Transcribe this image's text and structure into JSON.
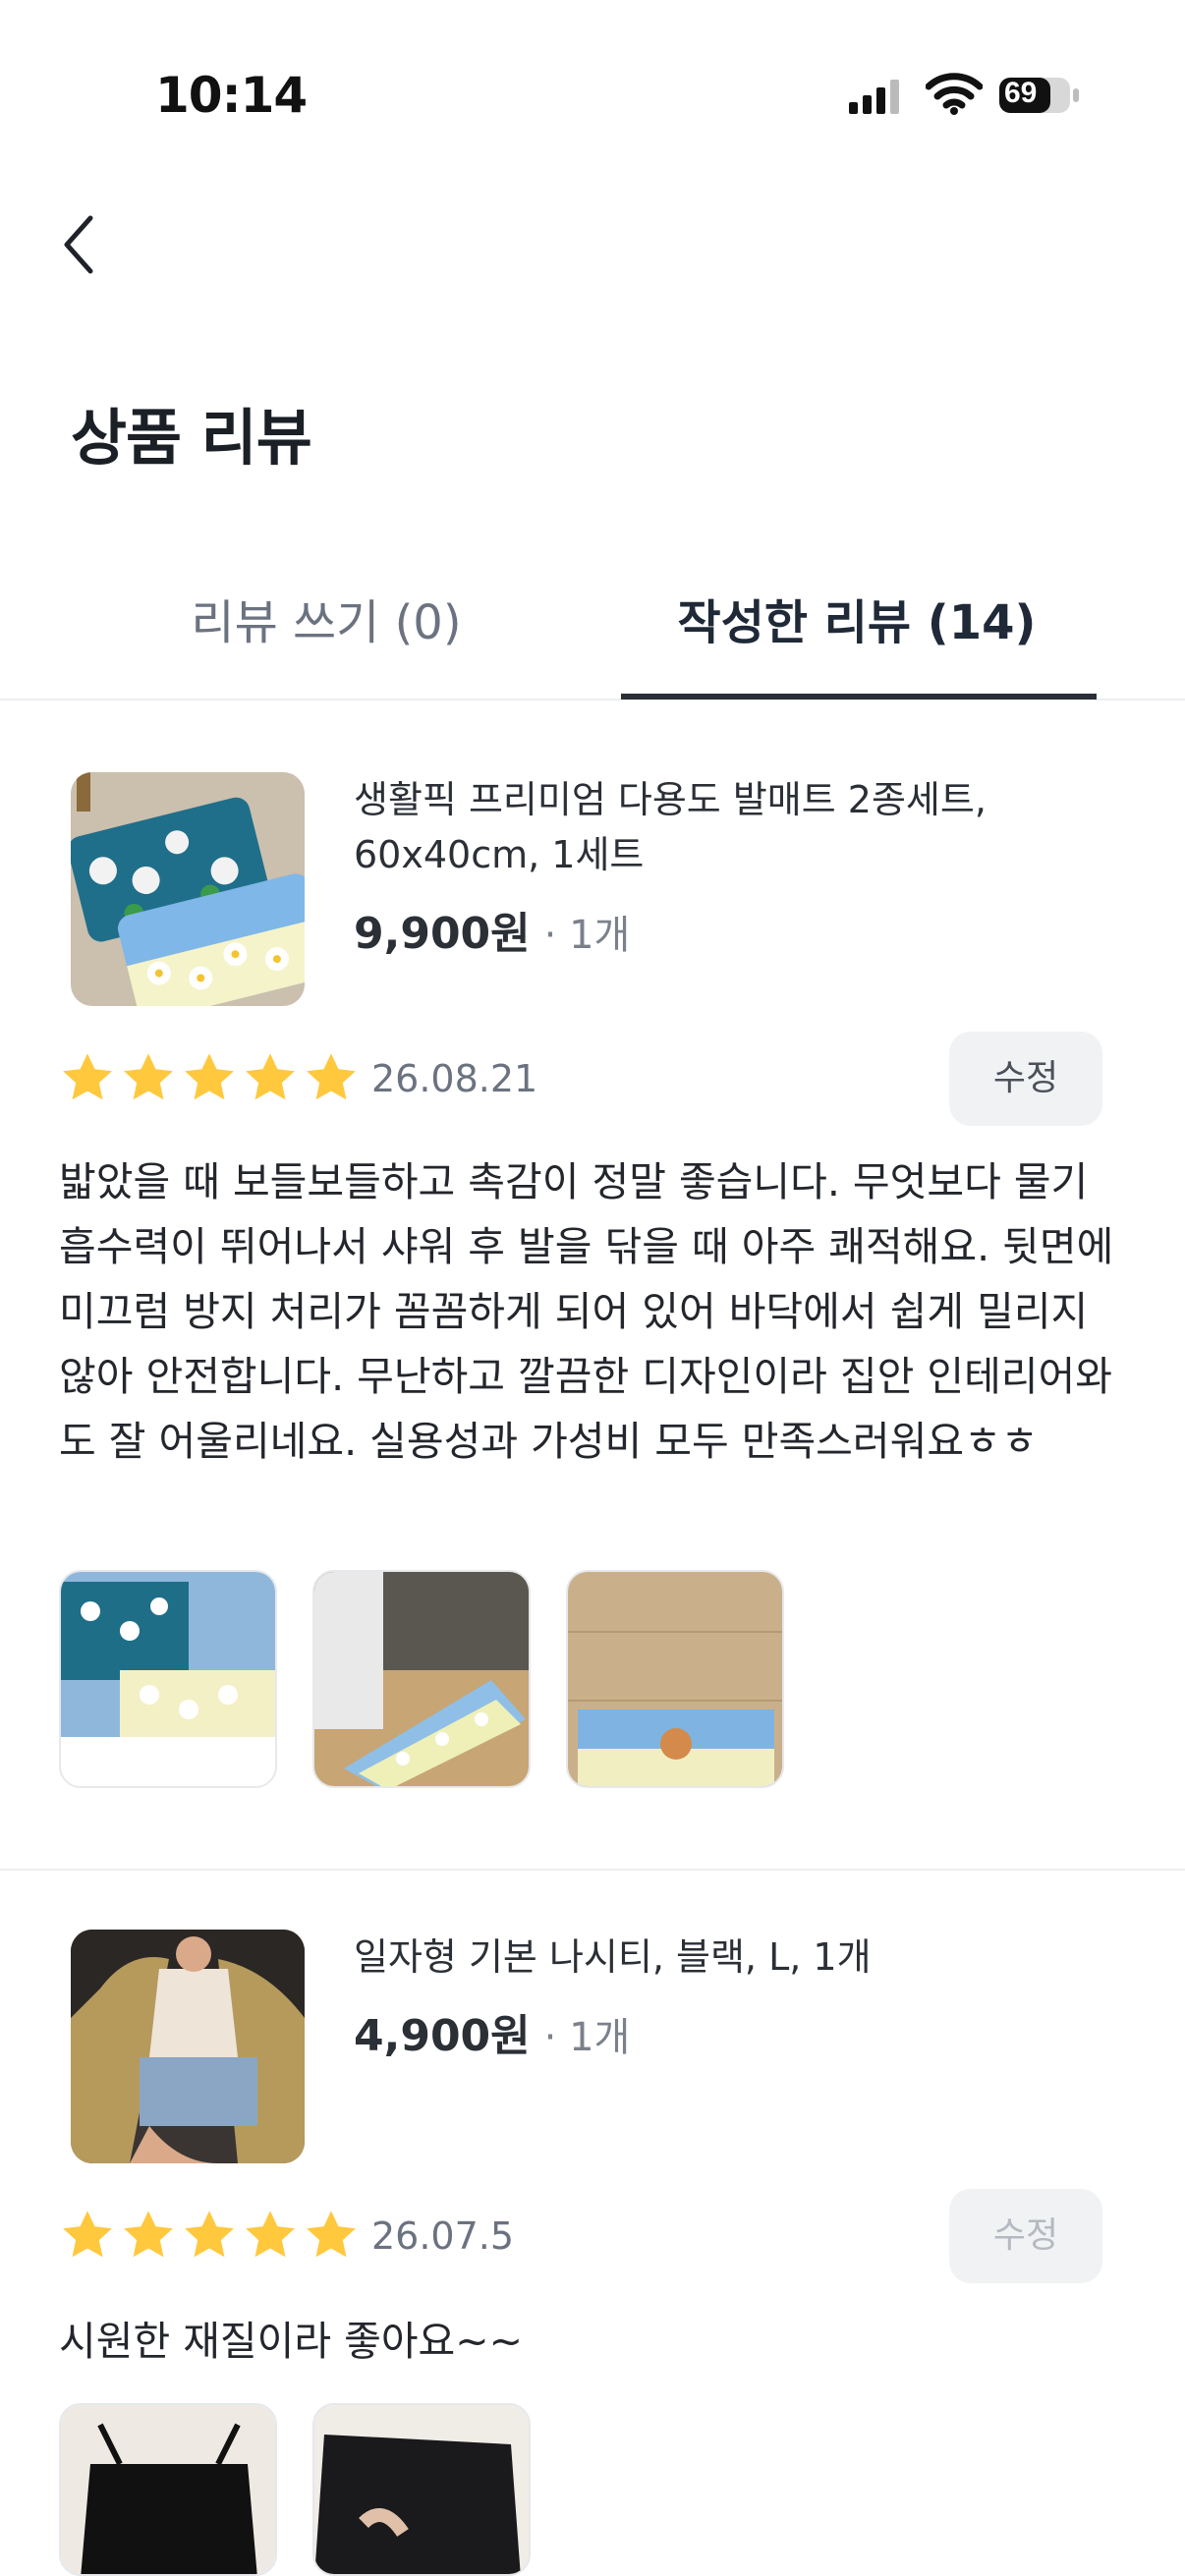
{
  "status_bar": {
    "time": "10:14",
    "battery": "69"
  },
  "header": {
    "title": "상품 리뷰"
  },
  "tabs": [
    {
      "label": "리뷰 쓰기 (0)",
      "active": false
    },
    {
      "label": "작성한 리뷰 (14)",
      "active": true
    }
  ],
  "reviews": [
    {
      "product_name": "생활픽 프리미엄 다용도 발매트 2종세트, 60x40cm, 1세트",
      "price": "9,900원",
      "quantity": "· 1개",
      "rating": 5,
      "date": "26.08.21",
      "edit_label": "수정",
      "text": "밟았을 때 보들보들하고 촉감이 정말 좋습니다. 무엇보다 물기 흡수력이 뛰어나서 샤워 후 발을 닦을 때 아주 쾌적해요. 뒷면에 미끄럼 방지 처리가 꼼꼼하게 되어 있어 바닥에서 쉽게 밀리지 않아 안전합니다. 무난하고 깔끔한 디자인이라 집안 인테리어와도 잘 어울리네요. 실용성과 가성비 모두 만족스러워요ㅎㅎ"
    },
    {
      "product_name": "일자형 기본 나시티, 블랙, L, 1개",
      "price": "4,900원",
      "quantity": "· 1개",
      "rating": 5,
      "date": "26.07.5",
      "edit_label": "수정",
      "text": "시원한 재질이라 좋아요~~"
    }
  ],
  "colors": {
    "star": "#FFC83D",
    "accent": "#2b2f36",
    "divider": "#eceef1"
  }
}
